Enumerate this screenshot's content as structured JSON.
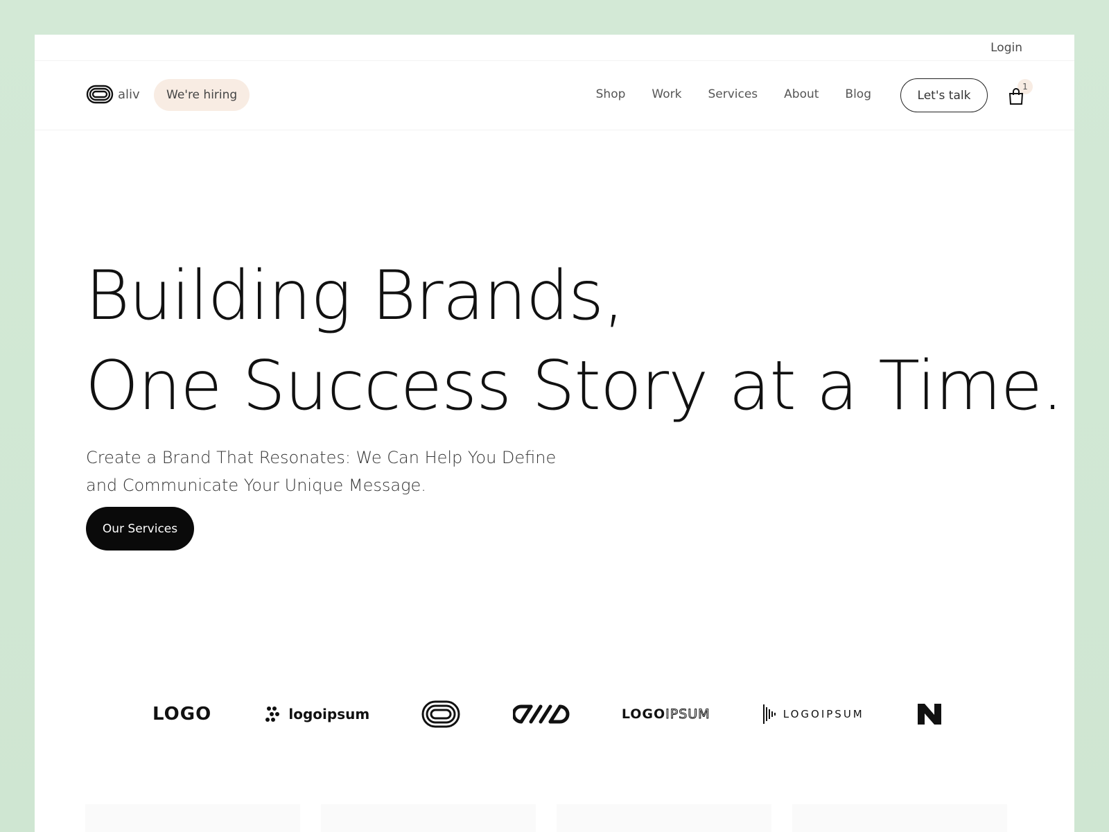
{
  "topbar": {
    "login_label": "Login"
  },
  "header": {
    "brand_name": "aliv",
    "hiring_label": "We're hiring",
    "nav": [
      "Shop",
      "Work",
      "Services",
      "About",
      "Blog"
    ],
    "talk_label": "Let's talk",
    "cart_count": "1"
  },
  "hero": {
    "title_line1": "Building Brands,",
    "title_line2": "One Success Story at a Time.",
    "subtitle_line1": "Create a Brand That Resonates: We Can Help You Define",
    "subtitle_line2": "and Communicate Your Unique Message.",
    "cta_label": "Our Services"
  },
  "logos": {
    "logo1_text": "LOGO",
    "logo2_text": "logoipsum",
    "logo5_bold": "LOGO",
    "logo5_outline": "IPSUM",
    "logo6_text": "LOGOIPSUM"
  },
  "colors": {
    "page_bg": "#d3e9d6",
    "hiring_bg": "#f8ece3",
    "cta_bg": "#0a0a0a"
  }
}
